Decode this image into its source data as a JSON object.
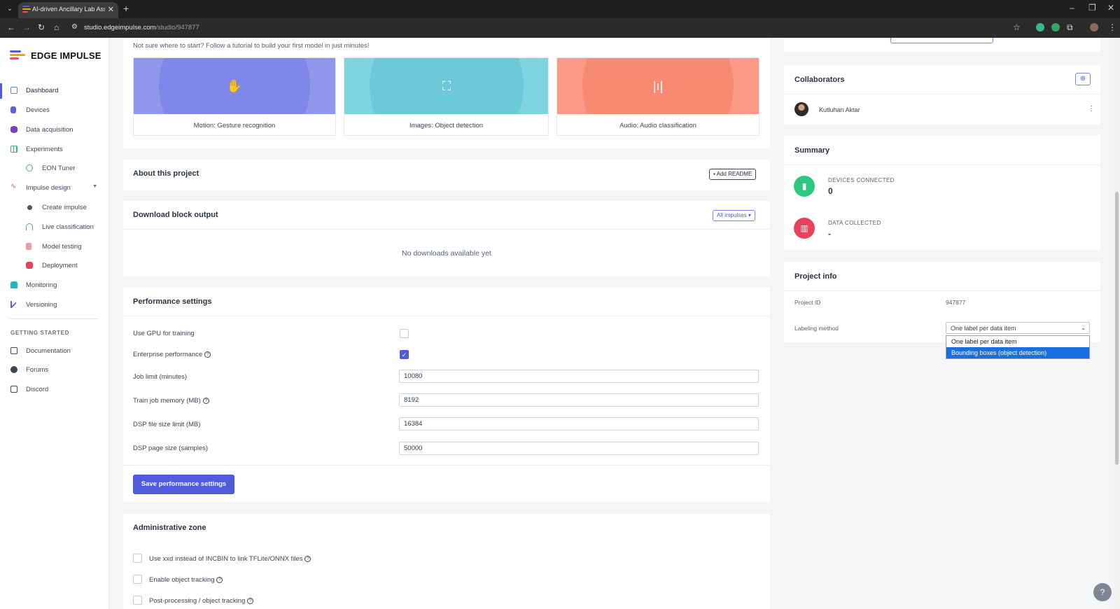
{
  "browser": {
    "tab_title": "AI-driven Ancillary Lab Assistant",
    "url_host": "studio.edgeimpulse.com",
    "url_path": "/studio/947877"
  },
  "sidebar": {
    "brand": "EDGE IMPULSE",
    "items": [
      {
        "label": "Dashboard",
        "icon": "monitor-icon",
        "color": "#4f8cdd"
      },
      {
        "label": "Devices",
        "icon": "device-icon",
        "color": "#5b5fe0"
      },
      {
        "label": "Data acquisition",
        "icon": "database-icon",
        "color": "#7b3fc4"
      },
      {
        "label": "Experiments",
        "icon": "grid-icon",
        "color": "#3bb58a"
      },
      {
        "label": "EON Tuner",
        "icon": "tuner-icon",
        "color": "#3bb58a"
      },
      {
        "label": "Impulse design",
        "icon": "pulse-icon",
        "color": "#e55353"
      },
      {
        "label": "Create impulse",
        "icon": "dot-icon",
        "color": "#555"
      },
      {
        "label": "Live classification",
        "icon": "live-icon",
        "color": "#3bb58a"
      },
      {
        "label": "Model testing",
        "icon": "clipboard-icon",
        "color": "#f19aa6"
      },
      {
        "label": "Deployment",
        "icon": "cube-icon",
        "color": "#e8415a"
      },
      {
        "label": "Monitoring",
        "icon": "monitoring-icon",
        "color": "#1fb5c5"
      },
      {
        "label": "Versioning",
        "icon": "branch-icon",
        "color": "#5b5fe0"
      }
    ],
    "section_label": "GETTING STARTED",
    "getting_started": [
      {
        "label": "Documentation",
        "icon": "doc-icon"
      },
      {
        "label": "Forums",
        "icon": "chat-icon"
      },
      {
        "label": "Discord",
        "icon": "discord-icon"
      }
    ]
  },
  "tutorials": {
    "intro": "Not sure where to start? Follow a tutorial to build your first model in just minutes!",
    "cards": [
      {
        "label": "Motion: Gesture recognition",
        "color": "#8f97ec",
        "inner": "#7f88e8"
      },
      {
        "label": "Images: Object detection",
        "color": "#7dd3e0",
        "inner": "#6ccad8"
      },
      {
        "label": "Audio: Audio classification",
        "color": "#fb9a84",
        "inner": "#f98a72"
      }
    ]
  },
  "about": {
    "title": "About this project",
    "add_readme": "Add README"
  },
  "download": {
    "title": "Download block output",
    "filter": "All impulses",
    "empty": "No downloads available yet"
  },
  "performance": {
    "title": "Performance settings",
    "use_gpu_label": "Use GPU for training",
    "enterprise_label": "Enterprise performance",
    "job_limit_label": "Job limit (minutes)",
    "job_limit_value": "10080",
    "train_mem_label": "Train job memory (MB)",
    "train_mem_value": "8192",
    "dsp_file_label": "DSP file size limit (MB)",
    "dsp_file_value": "16384",
    "dsp_page_label": "DSP page size (samples)",
    "dsp_page_value": "50000",
    "save_label": "Save performance settings"
  },
  "admin": {
    "title": "Administrative zone",
    "options": [
      "Use xxd instead of INCBIN to link TFLite/ONNX files",
      "Enable object tracking",
      "Post-processing / object tracking"
    ]
  },
  "collaborators": {
    "title": "Collaborators",
    "members": [
      {
        "name": "Kutluhan Aktar"
      }
    ]
  },
  "summary": {
    "title": "Summary",
    "devices_label": "DEVICES CONNECTED",
    "devices_value": "0",
    "data_label": "DATA COLLECTED",
    "data_value": "-"
  },
  "project_info": {
    "title": "Project info",
    "id_label": "Project ID",
    "id_value": "947877",
    "labeling_label": "Labeling method",
    "labeling_value": "One label per data item",
    "options": [
      "One label per data item",
      "Bounding boxes (object detection)"
    ]
  }
}
